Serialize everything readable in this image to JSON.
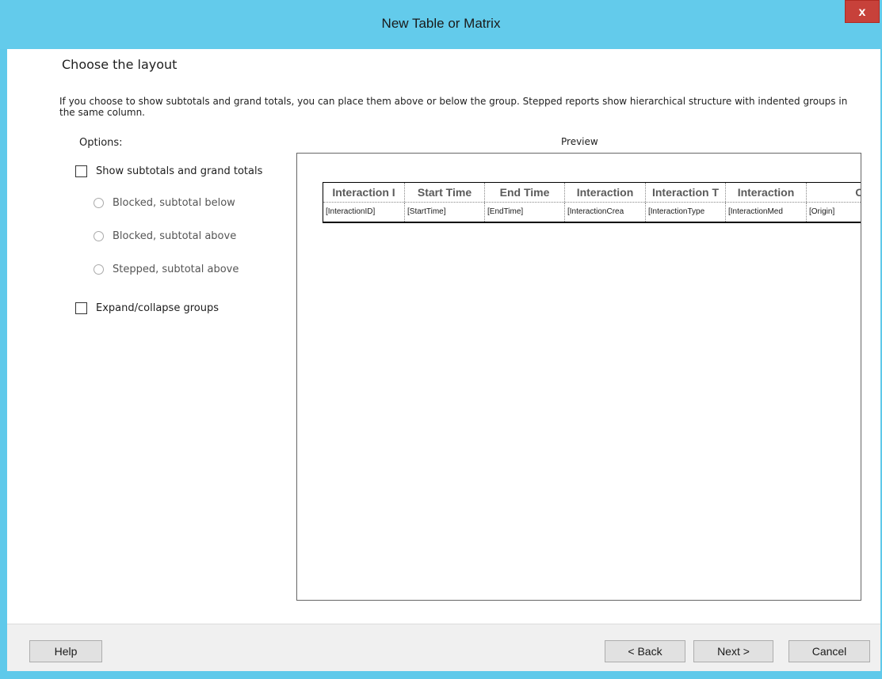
{
  "window": {
    "title": "New Table or Matrix",
    "close_label": "x"
  },
  "page": {
    "heading": "Choose the layout",
    "description": "If you choose to show subtotals and grand totals, you can place them above or below the group. Stepped reports show hierarchical structure with indented groups in the same column."
  },
  "options": {
    "label": "Options:",
    "show_totals": {
      "label": "Show subtotals and grand totals",
      "checked": false
    },
    "radios": [
      {
        "label": "Blocked, subtotal below",
        "enabled": false
      },
      {
        "label": "Blocked, subtotal above",
        "enabled": false
      },
      {
        "label": "Stepped, subtotal above",
        "enabled": false
      }
    ],
    "expand_collapse": {
      "label": "Expand/collapse groups",
      "checked": false
    }
  },
  "preview": {
    "label": "Preview",
    "headers": [
      "Interaction I",
      "Start Time",
      "End Time",
      "Interaction",
      "Interaction T",
      "Interaction",
      "Orig"
    ],
    "cells": [
      "[InteractionID]",
      "[StartTime]",
      "[EndTime]",
      "[InteractionCrea",
      "[InteractionType",
      "[InteractionMed",
      "[Origin]"
    ]
  },
  "buttons": {
    "help": "Help",
    "back": "< Back",
    "next": "Next >",
    "cancel": "Cancel"
  }
}
